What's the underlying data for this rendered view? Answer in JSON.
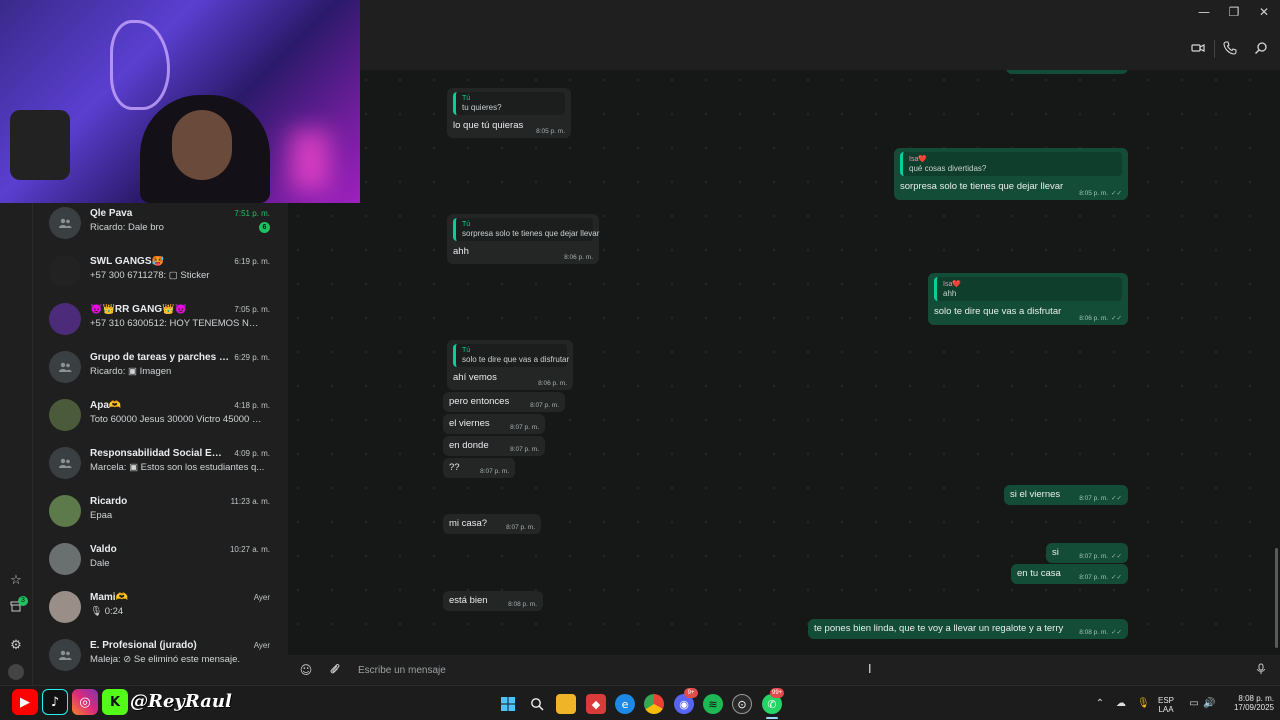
{
  "window": {
    "minimize": "—",
    "restore": "❐",
    "close": "✕"
  },
  "header": {
    "video_icon": "video-call-icon",
    "call_icon": "phone-icon",
    "search_icon": "search-icon"
  },
  "rail": {
    "starred_icon": "star-icon",
    "archive_badge": "3",
    "settings_icon": "gear-icon",
    "profile_icon": "avatar-icon"
  },
  "chats": [
    {
      "name": "Qle Pava",
      "preview": "Ricardo: Dale bro",
      "time": "7:51 p. m.",
      "unread": "6",
      "avatar": "group"
    },
    {
      "name": "SWL GANGS🥵",
      "preview": "+57 300 6711278: ▢ Sticker",
      "time": "6:19 p. m.",
      "avatar": "logo"
    },
    {
      "name": "😈👑RR GANG👑😈",
      "preview": "+57 310 6300512: HOY TENEMOS NOTI...",
      "time": "7:05 p. m.",
      "avatar": "photo"
    },
    {
      "name": "Grupo de tareas y parches jajaja",
      "preview": "Ricardo: ▣ Imagen",
      "time": "6:29 p. m.",
      "avatar": "group"
    },
    {
      "name": "Apa🫶",
      "preview": "Toto 60000 Jesus 30000 Victro 45000 Ri...",
      "time": "4:18 p. m.",
      "avatar": "photo"
    },
    {
      "name": "Responsabilidad Social Empre...",
      "preview": "Marcela: ▣ Estos son los estudiantes q...",
      "time": "4:09 p. m.",
      "avatar": "group"
    },
    {
      "name": "Ricardo",
      "preview": "Epaa",
      "time": "11:23 a. m.",
      "avatar": "photo"
    },
    {
      "name": "Valdo",
      "preview": "Dale",
      "time": "10:27 a. m.",
      "avatar": "photo"
    },
    {
      "name": "Mami🫶",
      "preview": "🎙 0:24",
      "time": "Ayer",
      "avatar": "photo"
    },
    {
      "name": "E. Profesional (jurado)",
      "preview": "Maleja: ⊘ Se eliminó este mensaje.",
      "time": "Ayer",
      "avatar": "group"
    }
  ],
  "messages": [
    {
      "dir": "in",
      "quote_author": "Tú",
      "quote_text": "tu quieres?",
      "text": "lo que tú quieras",
      "time": "8:05 p. m."
    },
    {
      "dir": "out",
      "quote_author": "Isa❤️",
      "quote_text": "qué cosas divertidas?",
      "text": "sorpresa solo te tienes que dejar llevar",
      "time": "8:05 p. m."
    },
    {
      "dir": "in",
      "quote_author": "Tú",
      "quote_text": "sorpresa solo te tienes que dejar llevar",
      "text": "ahh",
      "time": "8:06 p. m."
    },
    {
      "dir": "out",
      "quote_author": "Isa❤️",
      "quote_text": "ahh",
      "text": "solo te dire que vas a disfrutar",
      "time": "8:06 p. m."
    },
    {
      "dir": "in",
      "quote_author": "Tú",
      "quote_text": "solo te dire que vas a disfrutar",
      "text": "ahí vemos",
      "time": "8:06 p. m."
    },
    {
      "dir": "in",
      "text": "pero entonces",
      "time": "8:07 p. m."
    },
    {
      "dir": "in",
      "text": "el viernes",
      "time": "8:07 p. m."
    },
    {
      "dir": "in",
      "text": "en donde",
      "time": "8:07 p. m."
    },
    {
      "dir": "in",
      "text": "??",
      "time": "8:07 p. m."
    },
    {
      "dir": "out",
      "text": "si el viernes",
      "time": "8:07 p. m."
    },
    {
      "dir": "in",
      "text": "mi casa?",
      "time": "8:07 p. m."
    },
    {
      "dir": "out",
      "text": "si",
      "time": "8:07 p. m."
    },
    {
      "dir": "out",
      "text": "en tu casa",
      "time": "8:07 p. m."
    },
    {
      "dir": "in",
      "text": "está bien",
      "time": "8:08 p. m."
    },
    {
      "dir": "out",
      "text": "te pones bien linda, que te voy a llevar un regalote y a terry",
      "time": "8:08 p. m."
    }
  ],
  "composer": {
    "placeholder": "Escribe un mensaje",
    "emoji_icon": "emoji-icon",
    "attach_icon": "paperclip-icon",
    "mic_icon": "microphone-icon"
  },
  "stream_overlay": {
    "handle": "@ReyRaul",
    "socials": [
      "youtube",
      "tiktok",
      "instagram",
      "kick"
    ]
  },
  "taskbar": {
    "apps": [
      "windows-start",
      "search",
      "file-explorer",
      "app-red",
      "edge",
      "chrome",
      "discord",
      "spotify",
      "steam",
      "whatsapp"
    ],
    "discord_badge": "9+",
    "whatsapp_badge": "99+",
    "lang_top": "ESP",
    "lang_bottom": "LAA",
    "time": "8:08 p. m.",
    "date": "17/09/2025"
  },
  "colors": {
    "accent": "#21c063",
    "out_bubble": "#144d37",
    "in_bubble": "#242626",
    "background": "#161717"
  }
}
